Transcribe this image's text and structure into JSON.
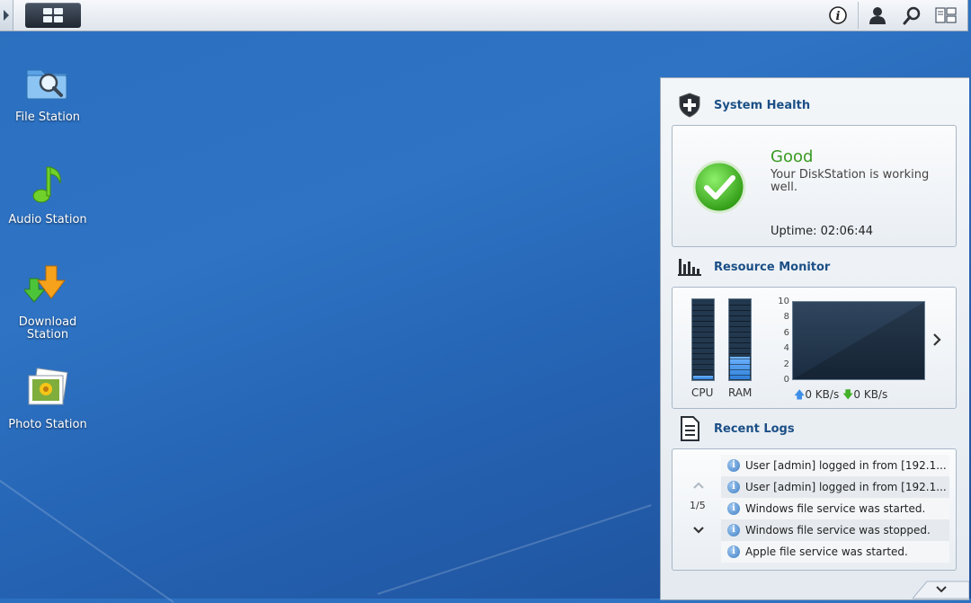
{
  "desktop_icons": [
    {
      "label": "File Station"
    },
    {
      "label": "Audio Station"
    },
    {
      "label": "Download Station"
    },
    {
      "label": "Photo Station"
    }
  ],
  "taskbar": {
    "icons": [
      "main-menu-icon",
      "info-icon",
      "user-icon",
      "search-icon",
      "widgets-icon"
    ]
  },
  "widgets": {
    "system_health": {
      "title": "System Health",
      "status": "Good",
      "message": "Your DiskStation is working well.",
      "uptime": "Uptime: 02:06:44",
      "status_color": "#3a9a22"
    },
    "resource_monitor": {
      "title": "Resource Monitor",
      "cpu_label": "CPU",
      "ram_label": "RAM",
      "cpu_level": 0.05,
      "ram_level": 0.28,
      "y_axis_ticks": [
        "10",
        "8",
        "6",
        "4",
        "2",
        "0"
      ],
      "upload_rate": "0 KB/s",
      "download_rate": "0 KB/s"
    },
    "recent_logs": {
      "title": "Recent Logs",
      "page": "1/5",
      "entries": [
        {
          "text": "User [admin] logged in from [192.1..."
        },
        {
          "text": "User [admin] logged in from [192.1..."
        },
        {
          "text": "Windows file service was started."
        },
        {
          "text": "Windows file service was stopped."
        },
        {
          "text": "Apple file service was started."
        }
      ]
    }
  },
  "colors": {
    "accent_title": "#1b4f86",
    "desktop_blue": "#2b6fc0",
    "meter_fill": "#3c8ee6"
  }
}
